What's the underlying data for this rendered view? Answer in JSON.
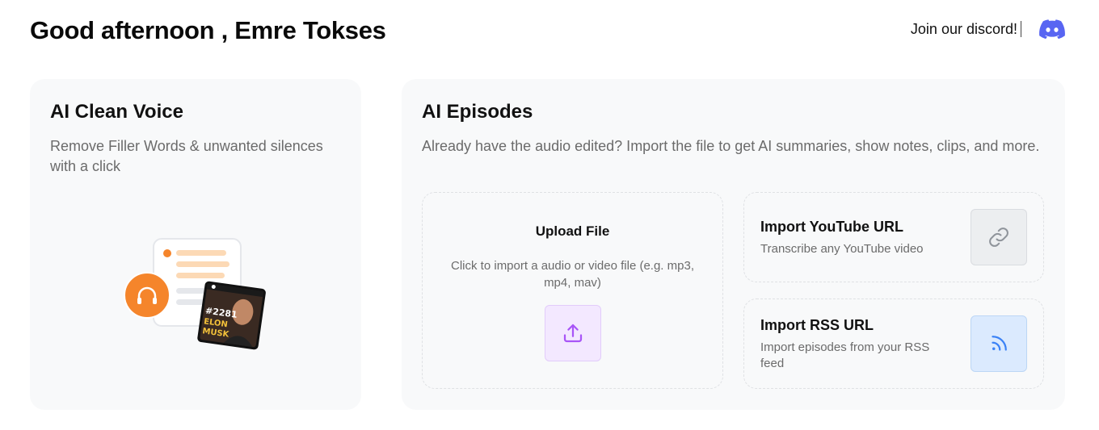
{
  "header": {
    "greeting": "Good afternoon , Emre Tokses",
    "discord_label": "Join our discord!",
    "discord_icon": "discord-icon",
    "discord_color": "#5865F2"
  },
  "voice_card": {
    "title": "AI Clean Voice",
    "description": "Remove Filler Words & unwanted silences with a click",
    "thumbnail_text": [
      "#2281",
      "ELON",
      "MUSK"
    ],
    "accent_color": "#f5852b"
  },
  "episodes_card": {
    "title": "AI Episodes",
    "description": "Already have the audio edited? Import the file to get AI summaries, show notes, clips, and more.",
    "upload": {
      "title": "Upload File",
      "description": "Click to import a audio or video file (e.g. mp3, mp4, mav)",
      "icon": "upload-icon",
      "accent_color": "#a855f7"
    },
    "youtube": {
      "title": "Import YouTube URL",
      "description": "Transcribe any YouTube video",
      "icon": "link-icon"
    },
    "rss": {
      "title": "Import RSS URL",
      "description": "Import episodes from your RSS feed",
      "icon": "rss-icon",
      "accent_color": "#3b82f6"
    }
  }
}
